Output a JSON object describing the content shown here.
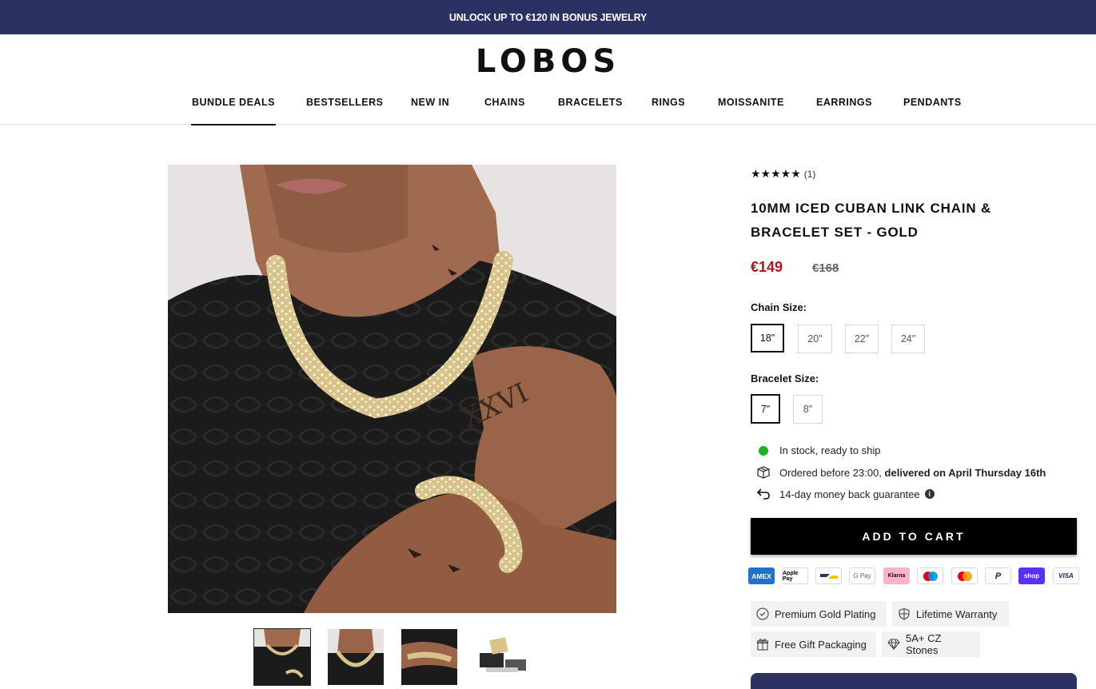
{
  "announcement": "UNLOCK UP TO €120 IN BONUS JEWELRY",
  "brand": "LOBOS",
  "nav": [
    {
      "label": "BUNDLE DEALS",
      "active": true
    },
    {
      "label": "BESTSELLERS"
    },
    {
      "label": "NEW IN"
    },
    {
      "label": "CHAINS"
    },
    {
      "label": "BRACELETS"
    },
    {
      "label": "RINGS"
    },
    {
      "label": "MOISSANITE"
    },
    {
      "label": "EARRINGS"
    },
    {
      "label": "PENDANTS"
    }
  ],
  "product": {
    "stars": "★★★★★",
    "rating": 5,
    "review_count": "(1)",
    "title": "10MM ICED CUBAN LINK CHAIN & BRACELET SET - GOLD",
    "price": "€149",
    "compare_price": "€168",
    "chain_size_label": "Chain Size:",
    "chain_sizes": [
      "18\"",
      "20\"",
      "22\"",
      "24\""
    ],
    "chain_selected": "18\"",
    "bracelet_size_label": "Bracelet Size:",
    "bracelet_sizes": [
      "7\"",
      "8\""
    ],
    "bracelet_selected": "7\"",
    "stock": "In stock, ready to ship",
    "delivery_prefix": "Ordered before 23:00,",
    "delivery_bold": "delivered on April Thursday 16th",
    "guarantee": "14-day money back guarantee",
    "add_to_cart": "ADD TO CART"
  },
  "payment_methods": [
    "AMEX",
    "Apple Pay",
    "Bancontact",
    "G Pay",
    "Klarna",
    "Maestro",
    "Mastercard",
    "PayPal",
    "shop",
    "VISA"
  ],
  "features": [
    "Premium Gold Plating",
    "Lifetime Warranty",
    "Free Gift Packaging",
    "5A+ CZ Stones"
  ],
  "colors": {
    "announcement_bg": "#2c3163",
    "price": "#b1141b",
    "in_stock": "#1fb028"
  }
}
